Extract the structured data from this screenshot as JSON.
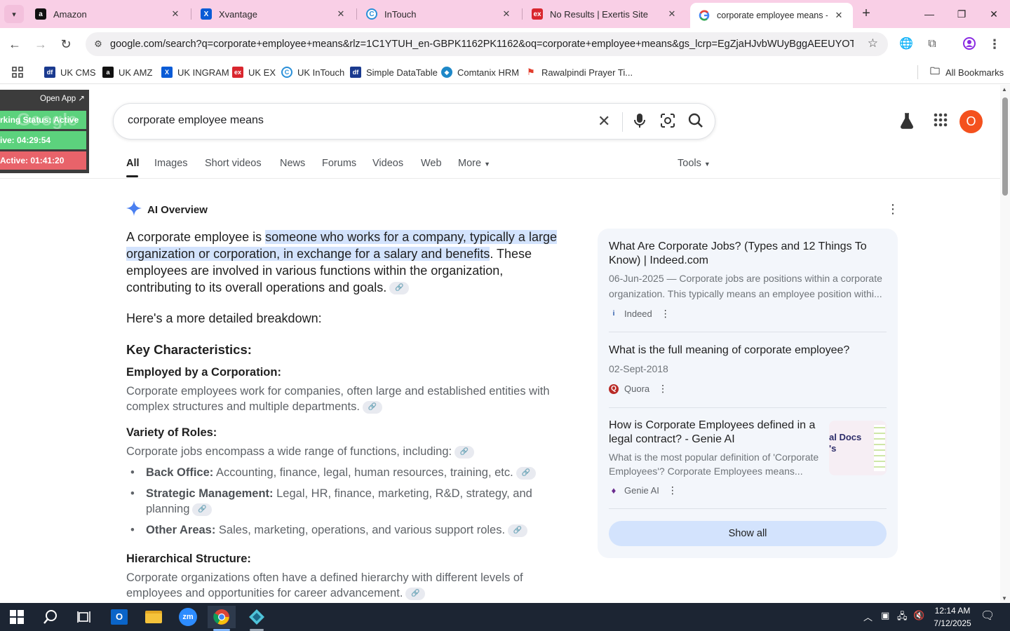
{
  "browser": {
    "tabs": [
      {
        "title": "Amazon",
        "favicon": "amazon-icon"
      },
      {
        "title": "Xvantage",
        "favicon": "xvantage-icon"
      },
      {
        "title": "InTouch",
        "favicon": "intouch-icon"
      },
      {
        "title": "No Results | Exertis Site",
        "favicon": "exertis-icon"
      },
      {
        "title": "corporate employee means - G",
        "favicon": "google-icon",
        "active": true
      }
    ],
    "url": "google.com/search?q=corporate+employee+means&rlz=1C1YTUH_en-GBPK1162PK1162&oq=corporate+employee+means&gs_lcrp=EgZjaHJvbWUyBggAEEUYOTIHCAE...",
    "bookmarks": [
      {
        "label": "UK CMS"
      },
      {
        "label": "UK AMZ"
      },
      {
        "label": "UK INGRAM"
      },
      {
        "label": "UK EX"
      },
      {
        "label": "UK InTouch"
      },
      {
        "label": "Simple DataTable"
      },
      {
        "label": "Comtanix HRM"
      },
      {
        "label": "Rawalpindi Prayer Ti..."
      }
    ],
    "all_bookmarks": "All Bookmarks"
  },
  "widget": {
    "open_app": "Open App ↗",
    "status": "rking Status: Active",
    "active_time": "ive: 04:29:54",
    "inactive_time": "Active: 01:41:20",
    "watermark": "Google"
  },
  "search": {
    "query": "corporate employee means",
    "tabs": [
      "All",
      "Images",
      "Short videos",
      "News",
      "Forums",
      "Videos",
      "Web",
      "More",
      "Tools"
    ],
    "avatar_letter": "O"
  },
  "ai_overview": {
    "label": "AI Overview",
    "intro_lead": "A corporate employee is ",
    "intro_highlight": "someone who works for a company, typically a large organization or corporation, in exchange for a salary and benefits",
    "intro_tail": ". These employees are involved in various functions within the organization, contributing to its overall operations and goals.",
    "breakdown": "Here's a more detailed breakdown:",
    "key_heading": "Key Characteristics:",
    "sections": [
      {
        "title": "Employed by a Corporation:",
        "body": "Corporate employees work for companies, often large and established entities with complex structures and multiple departments."
      },
      {
        "title": "Variety of Roles:",
        "body": "Corporate jobs encompass a wide range of functions, including:"
      },
      {
        "title": "Hierarchical Structure:",
        "body": "Corporate organizations often have a defined hierarchy with different levels of employees and opportunities for career advancement."
      }
    ],
    "bullets": [
      {
        "term": "Back Office:",
        "text": " Accounting, finance, legal, human resources, training, etc."
      },
      {
        "term": "Strategic Management:",
        "text": " Legal, HR, finance, marketing, R&D, strategy, and planning"
      },
      {
        "term": "Other Areas:",
        "text": " Sales, marketing, operations, and various support roles."
      }
    ]
  },
  "sources": [
    {
      "title": "What Are Corporate Jobs? (Types and 12 Things To Know) | Indeed.com",
      "snippet_1": "06-Jun-2025 — Corporate jobs are positions within a corporate",
      "snippet_2": "organization. This typically means an employee position withi...",
      "site": "Indeed"
    },
    {
      "title": "What is the full meaning of corporate employee?",
      "snippet_1": "02-Sept-2018",
      "site": "Quora"
    },
    {
      "title_1": "How is Corporate Employees defined in a",
      "title_2": "legal contract? - Genie AI",
      "snippet_1": "What is the most popular definition of 'Corporate",
      "snippet_2": "Employees'? Corporate Employees means...",
      "site": "Genie AI",
      "thumb_text_1": "al Docs",
      "thumb_text_2": "'s"
    }
  ],
  "show_all": "Show all",
  "taskbar": {
    "time": "12:14 AM",
    "date": "7/12/2025"
  },
  "colors": {
    "tabstrip": "#f9cfe6",
    "highlight": "#d3e3fd",
    "widget_green": "#5cd27d",
    "widget_red": "#e8636a",
    "avatar": "#f4511e"
  }
}
